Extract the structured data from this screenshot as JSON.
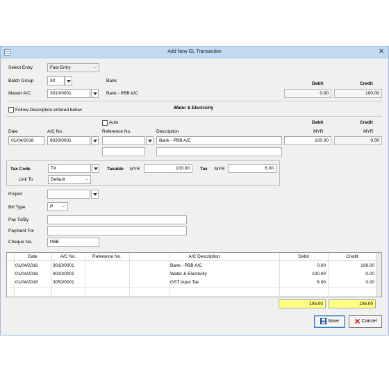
{
  "window": {
    "title": "Add New GL Transaction",
    "close_glyph": "✕"
  },
  "select_entry": {
    "label": "Select Entry",
    "value": "Fast Entry"
  },
  "batch_group": {
    "label": "Batch Group",
    "value": "30",
    "desc": "Bank"
  },
  "master_ac": {
    "label": "Master A/C",
    "value": "3010/0001",
    "desc": "Bank - PBB A/C"
  },
  "top_totals": {
    "debit_label": "Debit",
    "credit_label": "Credit",
    "debit": "0.00",
    "credit": "100.00"
  },
  "follow_desc": {
    "label": "Follow Description entered below",
    "checked": false
  },
  "journal_title": "Water & Electricity",
  "auto": {
    "label": "Auto",
    "checked": false
  },
  "entry_headers": {
    "date": "Date",
    "ac_no": "A/C No.",
    "ref_no": "Reference No.",
    "description": "Description",
    "debit": "Debit",
    "credit": "Credit",
    "debit_cur": "MYR",
    "credit_cur": "MYR"
  },
  "entry": {
    "date": "01/04/2016",
    "ac_no": "9020/0001",
    "ref_no": "",
    "ref_no2": "",
    "description": "Bank - PBB A/C",
    "description2": "",
    "debit": "100.00",
    "credit": "0.00"
  },
  "tax": {
    "code_label": "Tax Code",
    "code": "TX",
    "taxable_label": "Taxable",
    "taxable_cur": "MYR",
    "taxable": "100.00",
    "tax_label": "Tax",
    "tax_cur": "MYR",
    "tax": "6.00",
    "link_label": "Link To",
    "link": "Default"
  },
  "project": {
    "label": "Project",
    "value": ""
  },
  "bill_type": {
    "label": "Bill Type",
    "value": "P"
  },
  "pay_to": {
    "label": "Pay To/By",
    "value": ""
  },
  "payment_for": {
    "label": "Payment For",
    "value": ""
  },
  "cheque": {
    "label": "Cheque No.",
    "value": "PBB"
  },
  "grid": {
    "headers": [
      "Date",
      "A/C No.",
      "Reference No.",
      "A/C Description",
      "Debit",
      "Credit"
    ],
    "rows": [
      {
        "date": "01/04/2016",
        "ac": "3010/0001",
        "ref": "",
        "desc": "Bank - PBB A/C",
        "debit": "0.00",
        "credit": "106.00"
      },
      {
        "date": "01/04/2016",
        "ac": "9020/0001",
        "ref": "",
        "desc": "Water & Electricity",
        "debit": "100.00",
        "credit": "0.00"
      },
      {
        "date": "01/04/2016",
        "ac": "3050/0001",
        "ref": "",
        "desc": "GST Input Tax",
        "debit": "6.00",
        "credit": "0.00"
      }
    ]
  },
  "totals": {
    "debit": "106.00",
    "credit": "106.00"
  },
  "buttons": {
    "save": "Save",
    "cancel": "Cancel"
  },
  "colors": {
    "titlebar": "#c4d9f2",
    "total_highlight": "#ffff80",
    "cancel_icon": "#d62828",
    "save_icon": "#2a5da8"
  }
}
